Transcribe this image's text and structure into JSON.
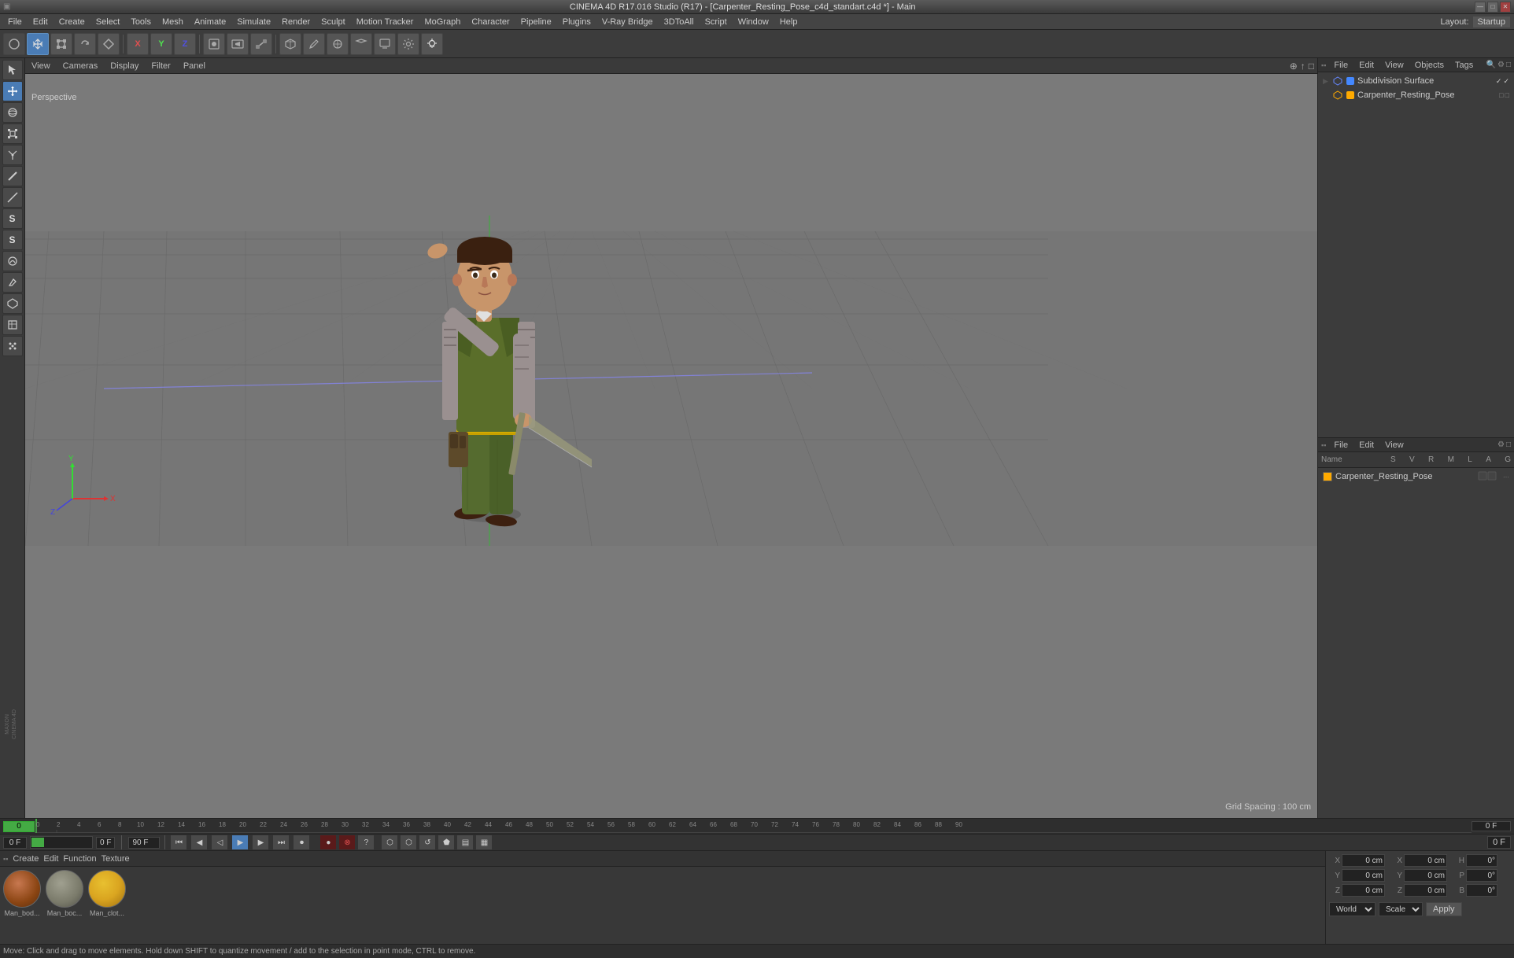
{
  "window": {
    "title": "CINEMA 4D R17.016 Studio (R17) - [Carpenter_Resting_Pose_c4d_standart.c4d *] - Main",
    "min_btn": "—",
    "max_btn": "□",
    "close_btn": "✕"
  },
  "menu": {
    "items": [
      "File",
      "Edit",
      "Create",
      "Select",
      "Tools",
      "Mesh",
      "Animate",
      "Simulate",
      "Render",
      "Sculpt",
      "Motion Tracker",
      "MoGraph",
      "Character",
      "Pipeline",
      "Plugins",
      "V-Ray Bridge",
      "3DToAll",
      "Script",
      "Window",
      "Help"
    ],
    "layout_label": "Layout:",
    "layout_value": "Startup"
  },
  "toolbar": {
    "tools": [
      "←",
      "✦",
      "□",
      "↺",
      "⊕",
      "✕",
      "Y",
      "Z",
      "⬡",
      "⬜",
      "►",
      "◼",
      "⬟",
      "⬡",
      "⊕",
      "⬡",
      "✎",
      "⬡",
      "⬟",
      "⬡",
      "⬡",
      "⬟",
      "⬡",
      "●",
      "◈"
    ]
  },
  "left_sidebar": {
    "tools": [
      "arrow",
      "move",
      "rotate",
      "scale",
      "line",
      "curve",
      "sphere",
      "box",
      "cylinder",
      "cone",
      "plane",
      "disc",
      "torus",
      "capsule",
      "tube",
      "figure",
      "spline",
      "null",
      "camera",
      "light"
    ]
  },
  "viewport": {
    "menus": [
      "View",
      "Cameras",
      "Display",
      "Filter",
      "Panel"
    ],
    "label": "Perspective",
    "grid_spacing": "Grid Spacing : 100 cm"
  },
  "objects_panel": {
    "header_menus": [
      "File",
      "Edit",
      "View",
      "Objects",
      "Tags"
    ],
    "items": [
      {
        "name": "Subdivision Surface",
        "icon": "⬡",
        "color": "#4488ff",
        "checked_green": true,
        "checked_white": true
      },
      {
        "name": "Carpenter_Resting_Pose",
        "icon": "⬡",
        "color": "#ffaa00",
        "checked_green": false,
        "checked_white": false
      }
    ]
  },
  "attributes_panel": {
    "header_menus": [
      "File",
      "Edit",
      "View"
    ],
    "columns": [
      "Name",
      "S",
      "V",
      "R",
      "M",
      "L",
      "A",
      "G"
    ],
    "items": [
      {
        "name": "Carpenter_Resting_Pose",
        "color": "#ffaa00"
      }
    ]
  },
  "timeline": {
    "start_frame": "0",
    "end_frame": "90",
    "current_frame": "0",
    "frame_suffix": "F",
    "max_frame": "90 F",
    "ticks": [
      "0",
      "2",
      "4",
      "6",
      "8",
      "10",
      "12",
      "14",
      "16",
      "18",
      "20",
      "22",
      "24",
      "26",
      "28",
      "30",
      "32",
      "34",
      "36",
      "38",
      "40",
      "42",
      "44",
      "46",
      "48",
      "50",
      "52",
      "54",
      "56",
      "58",
      "60",
      "62",
      "64",
      "66",
      "68",
      "70",
      "72",
      "74",
      "76",
      "78",
      "80",
      "82",
      "84",
      "86",
      "88",
      "90"
    ],
    "playback": {
      "go_start": "⏮",
      "prev_frame": "◀",
      "play": "▶",
      "next_frame": "▶",
      "go_end": "⏭",
      "record": "●"
    }
  },
  "materials": {
    "menus": [
      "Create",
      "Edit",
      "Function",
      "Texture"
    ],
    "items": [
      {
        "name": "Man_bod...",
        "color": "#8B4513"
      },
      {
        "name": "Man_boc...",
        "color": "#6B8E23"
      },
      {
        "name": "Man_clot...",
        "color": "#DAA520"
      }
    ]
  },
  "coordinates": {
    "x_label": "X",
    "y_label": "Y",
    "z_label": "Z",
    "x_pos": "0 cm",
    "y_pos": "0 cm",
    "z_pos": "0 cm",
    "h_label": "H",
    "p_label": "P",
    "b_label": "B",
    "h_val": "0°",
    "p_val": "0°",
    "b_val": "0°",
    "sx_label": "X",
    "sy_label": "Y",
    "sz_label": "Z",
    "sx_val": "0 cm",
    "sy_val": "0 cm",
    "sz_val": "0 cm",
    "world_label": "World",
    "scale_label": "Scale",
    "apply_label": "Apply"
  },
  "status_bar": {
    "text": "Move: Click and drag to move elements. Hold down SHIFT to quantize movement / add to the selection in point mode, CTRL to remove."
  }
}
